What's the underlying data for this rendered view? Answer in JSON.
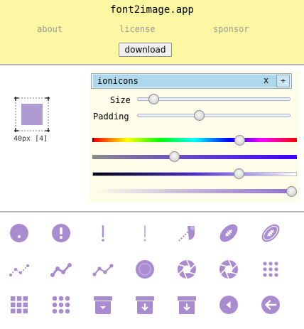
{
  "header": {
    "title": "font2image.app",
    "nav": [
      "about",
      "license",
      "sponsor"
    ],
    "download_label": "download"
  },
  "preview": {
    "size_label": "40px [4]",
    "color": "#b09ad4"
  },
  "controls": {
    "font_name": "ionicons",
    "clear_label": "x",
    "add_label": "+",
    "size_label": "Size",
    "padding_label": "Padding",
    "size_value": 0.09,
    "padding_value": 0.4,
    "hue_value": 0.72,
    "saturation_value": 0.4,
    "lightness_value": 0.71,
    "alpha_value": 1.0
  },
  "colors": {
    "header_bg": "#fbf7a3",
    "icon": "#a98bd0",
    "panel_bg": "#fdfde9",
    "input_bg": "#aed9ec"
  },
  "icons": [
    "help-circle-outline-icon",
    "alert-circle-icon",
    "exclamation-icon",
    "exclamation-outline-icon",
    "aperture-slash-icon",
    "football-icon",
    "football-outline-icon",
    "analytics-outline-icon",
    "analytics-icon",
    "analytics-sharp-icon",
    "aperture-circle-icon",
    "aperture-icon",
    "aperture-outline-icon",
    "apps-dots-icon",
    "apps-grid-icon",
    "apps-grid-dots-icon",
    "archive-drop-icon",
    "archive-download-icon",
    "archive-download-sharp-icon",
    "caret-back-circle-icon",
    "arrow-back-circle-icon"
  ]
}
